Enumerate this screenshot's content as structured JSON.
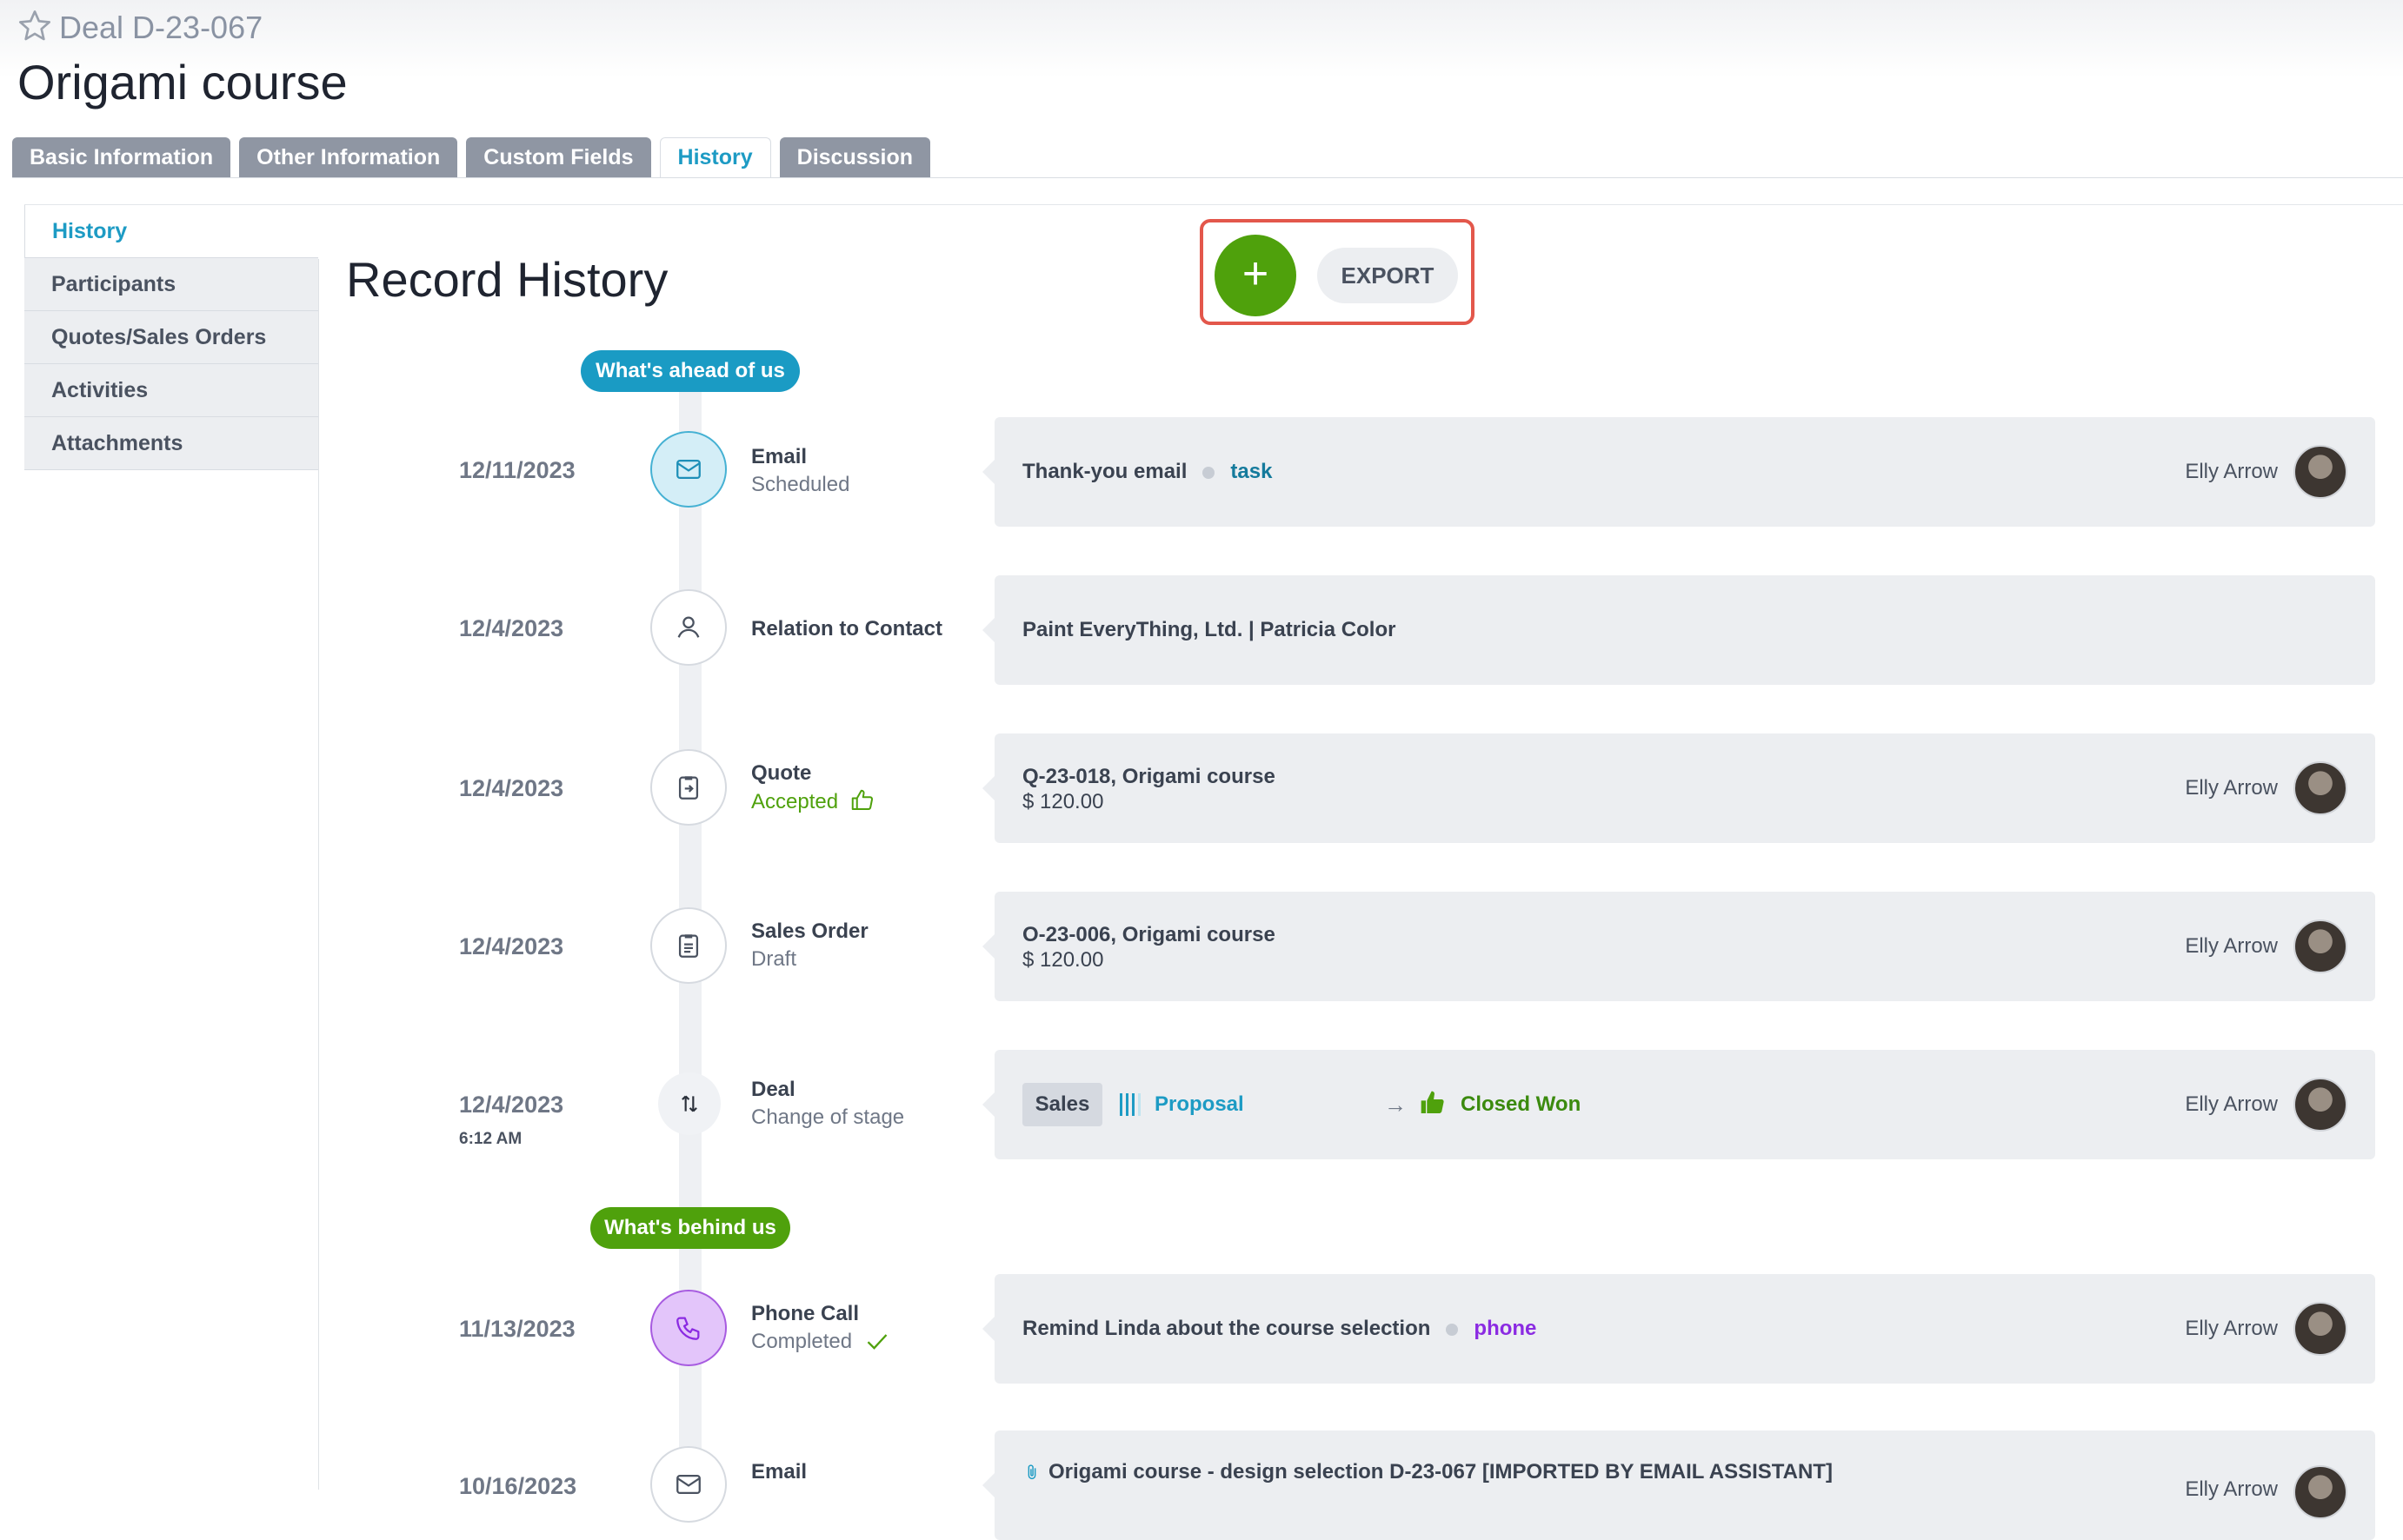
{
  "header": {
    "deal_id": "Deal D-23-067",
    "title": "Origami course"
  },
  "tabs": [
    {
      "label": "Basic Information",
      "active": false
    },
    {
      "label": "Other Information",
      "active": false
    },
    {
      "label": "Custom Fields",
      "active": false
    },
    {
      "label": "History",
      "active": true
    },
    {
      "label": "Discussion",
      "active": false
    }
  ],
  "sidenav": [
    {
      "label": "History",
      "active": true
    },
    {
      "label": "Participants",
      "active": false
    },
    {
      "label": "Quotes/Sales Orders",
      "active": false
    },
    {
      "label": "Activities",
      "active": false
    },
    {
      "label": "Attachments",
      "active": false
    }
  ],
  "main": {
    "title": "Record History",
    "add_label": "+",
    "export_label": "EXPORT",
    "ahead_label": "What's ahead of us",
    "behind_label": "What's behind us"
  },
  "entries": [
    {
      "date": "12/11/2023",
      "type": "Email",
      "status": "Scheduled",
      "text": "Thank-you email",
      "tag": "task",
      "owner": "Elly Arrow",
      "icon": "envelope-icon"
    },
    {
      "date": "12/4/2023",
      "type": "Relation to Contact",
      "text": "Paint EveryThing, Ltd. | Patricia Color",
      "icon": "person-icon"
    },
    {
      "date": "12/4/2023",
      "type": "Quote",
      "status": "Accepted",
      "text": "Q-23-018, Origami course",
      "amount": "$ 120.00",
      "owner": "Elly Arrow",
      "icon": "quote-icon"
    },
    {
      "date": "12/4/2023",
      "type": "Sales Order",
      "status": "Draft",
      "text": "O-23-006, Origami course",
      "amount": "$ 120.00",
      "owner": "Elly Arrow",
      "icon": "clipboard-icon"
    },
    {
      "date": "12/4/2023",
      "time": "6:12 AM",
      "type": "Deal",
      "status": "Change of stage",
      "pipeline": "Sales",
      "from_stage": "Proposal",
      "to_stage": "Closed Won",
      "owner": "Elly Arrow",
      "icon": "swap-arrows-icon"
    },
    {
      "date": "11/13/2023",
      "type": "Phone Call",
      "status": "Completed",
      "text": "Remind Linda about the course selection",
      "tag": "phone",
      "owner": "Elly Arrow",
      "icon": "phone-icon"
    },
    {
      "date": "10/16/2023",
      "type": "Email",
      "text": "Origami course - design selection D-23-067 [IMPORTED BY EMAIL ASSISTANT]",
      "owner": "Elly Arrow",
      "icon": "envelope-icon"
    }
  ],
  "colors": {
    "accent": "#1d9bc4",
    "green": "#4fa10c",
    "purple": "#8b2be2",
    "highlight": "#e3574b"
  }
}
